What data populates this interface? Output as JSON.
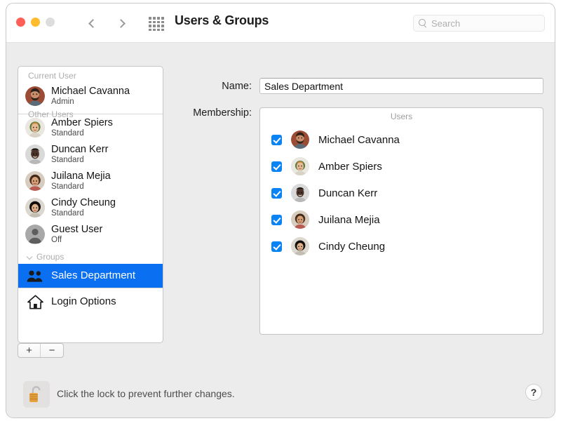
{
  "window": {
    "title": "Users & Groups",
    "traffic_lights": [
      "close",
      "minimize",
      "zoom-disabled"
    ],
    "back_icon": "chevron-left-icon",
    "forward_icon": "chevron-right-icon",
    "grid_icon": "grid-apps-icon"
  },
  "search": {
    "placeholder": "Search",
    "value": "",
    "icon": "search-icon"
  },
  "sidebar": {
    "sections": [
      {
        "header": "Current User",
        "collapsible": false,
        "items": [
          {
            "name": "Michael Cavanna",
            "role": "Admin",
            "avatar": "photo-man-beard",
            "selected": false,
            "kind": "user"
          }
        ]
      },
      {
        "header": "Other Users",
        "collapsible": false,
        "items": [
          {
            "name": "Amber Spiers",
            "role": "Standard",
            "avatar": "photo-woman-blonde",
            "selected": false,
            "kind": "user"
          },
          {
            "name": "Duncan Kerr",
            "role": "Standard",
            "avatar": "photo-man-dark",
            "selected": false,
            "kind": "user"
          },
          {
            "name": "Juilana Mejia",
            "role": "Standard",
            "avatar": "photo-woman-brown",
            "selected": false,
            "kind": "user"
          },
          {
            "name": "Cindy Cheung",
            "role": "Standard",
            "avatar": "photo-woman-black-hair",
            "selected": false,
            "kind": "user"
          },
          {
            "name": "Guest User",
            "role": "Off",
            "avatar": "generic-person-icon",
            "selected": false,
            "kind": "user"
          }
        ]
      },
      {
        "header": "Groups",
        "collapsible": true,
        "disclosure_icon": "chevron-down-icon",
        "items": [
          {
            "name": "Sales Department",
            "role": "",
            "avatar": "two-people-icon",
            "selected": true,
            "kind": "group"
          }
        ]
      }
    ],
    "login_options": {
      "label": "Login Options",
      "icon": "house-icon"
    },
    "add_button": "+",
    "remove_button": "−"
  },
  "detail": {
    "name_label": "Name:",
    "name_value": "Sales Department",
    "membership_label": "Membership:",
    "membership_header": "Users",
    "members": [
      {
        "name": "Michael Cavanna",
        "checked": true,
        "avatar": "photo-man-beard"
      },
      {
        "name": "Amber Spiers",
        "checked": true,
        "avatar": "photo-woman-blonde"
      },
      {
        "name": "Duncan Kerr",
        "checked": true,
        "avatar": "photo-man-dark"
      },
      {
        "name": "Juilana Mejia",
        "checked": true,
        "avatar": "photo-woman-brown"
      },
      {
        "name": "Cindy Cheung",
        "checked": true,
        "avatar": "photo-woman-black-hair"
      }
    ]
  },
  "footer": {
    "lock_icon": "padlock-open-icon",
    "lock_text": "Click the lock to prevent further changes.",
    "help_label": "?"
  },
  "colors": {
    "selection_blue": "#0a6ff0",
    "checkbox_blue": "#0a84f5",
    "window_bg": "#ececec",
    "titlebar_bg": "#ffffff",
    "lock_gold": "#e09b2d"
  }
}
